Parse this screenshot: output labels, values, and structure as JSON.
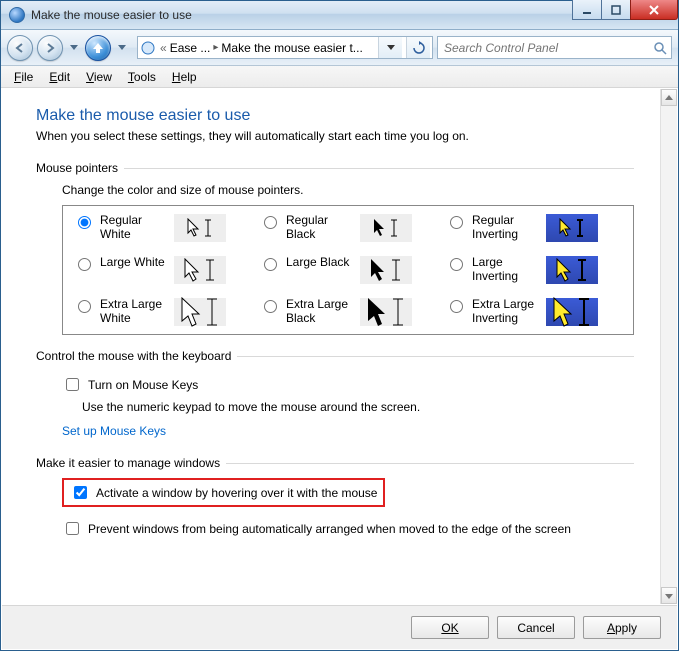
{
  "window": {
    "title": "Make the mouse easier to use"
  },
  "breadcrumbs": {
    "parent": "Ease ...",
    "current": "Make the mouse easier t..."
  },
  "search": {
    "placeholder": "Search Control Panel"
  },
  "menu": {
    "file": "File",
    "edit": "Edit",
    "view": "View",
    "tools": "Tools",
    "help": "Help"
  },
  "page": {
    "title": "Make the mouse easier to use",
    "subtitle": "When you select these settings, they will automatically start each time you log on."
  },
  "sections": {
    "pointers": {
      "legend": "Mouse pointers",
      "caption": "Change the color and size of mouse pointers.",
      "options": {
        "reg_white": "Regular White",
        "reg_black": "Regular Black",
        "reg_inv": "Regular Inverting",
        "lg_white": "Large White",
        "lg_black": "Large Black",
        "lg_inv": "Large Inverting",
        "xl_white": "Extra Large White",
        "xl_black": "Extra Large Black",
        "xl_inv": "Extra Large Inverting"
      }
    },
    "keyboard": {
      "legend": "Control the mouse with the keyboard",
      "turn_on": "Turn on Mouse Keys",
      "note": "Use the numeric keypad to move the mouse around the screen.",
      "link": "Set up Mouse Keys"
    },
    "windows": {
      "legend": "Make it easier to manage windows",
      "activate": "Activate a window by hovering over it with the mouse",
      "prevent": "Prevent windows from being automatically arranged when moved to the edge of the screen"
    }
  },
  "buttons": {
    "ok": "OK",
    "cancel": "Cancel",
    "apply": "Apply"
  }
}
